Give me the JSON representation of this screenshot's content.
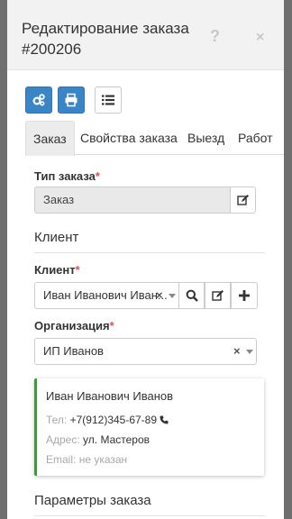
{
  "modal": {
    "title": "Редактирование заказа #200206"
  },
  "tabs": [
    {
      "label": "Заказ"
    },
    {
      "label": "Свойства заказа"
    },
    {
      "label": "Выезд"
    },
    {
      "label": "Работ"
    }
  ],
  "order_type": {
    "label": "Тип заказа",
    "required_mark": "*",
    "value": "Заказ"
  },
  "client_section": {
    "title": "Клиент"
  },
  "client": {
    "label": "Клиент",
    "required_mark": "*",
    "value": "Иван Иванович Иван...",
    "clear": "×"
  },
  "organization": {
    "label": "Организация",
    "required_mark": "*",
    "value": "ИП Иванов",
    "clear": "×"
  },
  "client_card": {
    "name": "Иван Иванович Иванов",
    "phone_label": "Тел:",
    "phone_value": "+7(912)345-67-89",
    "address_label": "Адрес:",
    "address_value": "ул. Мастеров",
    "email_label": "Email:",
    "email_value": "не указан"
  },
  "params_section": {
    "title": "Параметры заказа"
  },
  "colors": {
    "primary_button": "#3a85c5",
    "required": "#d9534f",
    "card_accent": "#3c9a3c"
  }
}
